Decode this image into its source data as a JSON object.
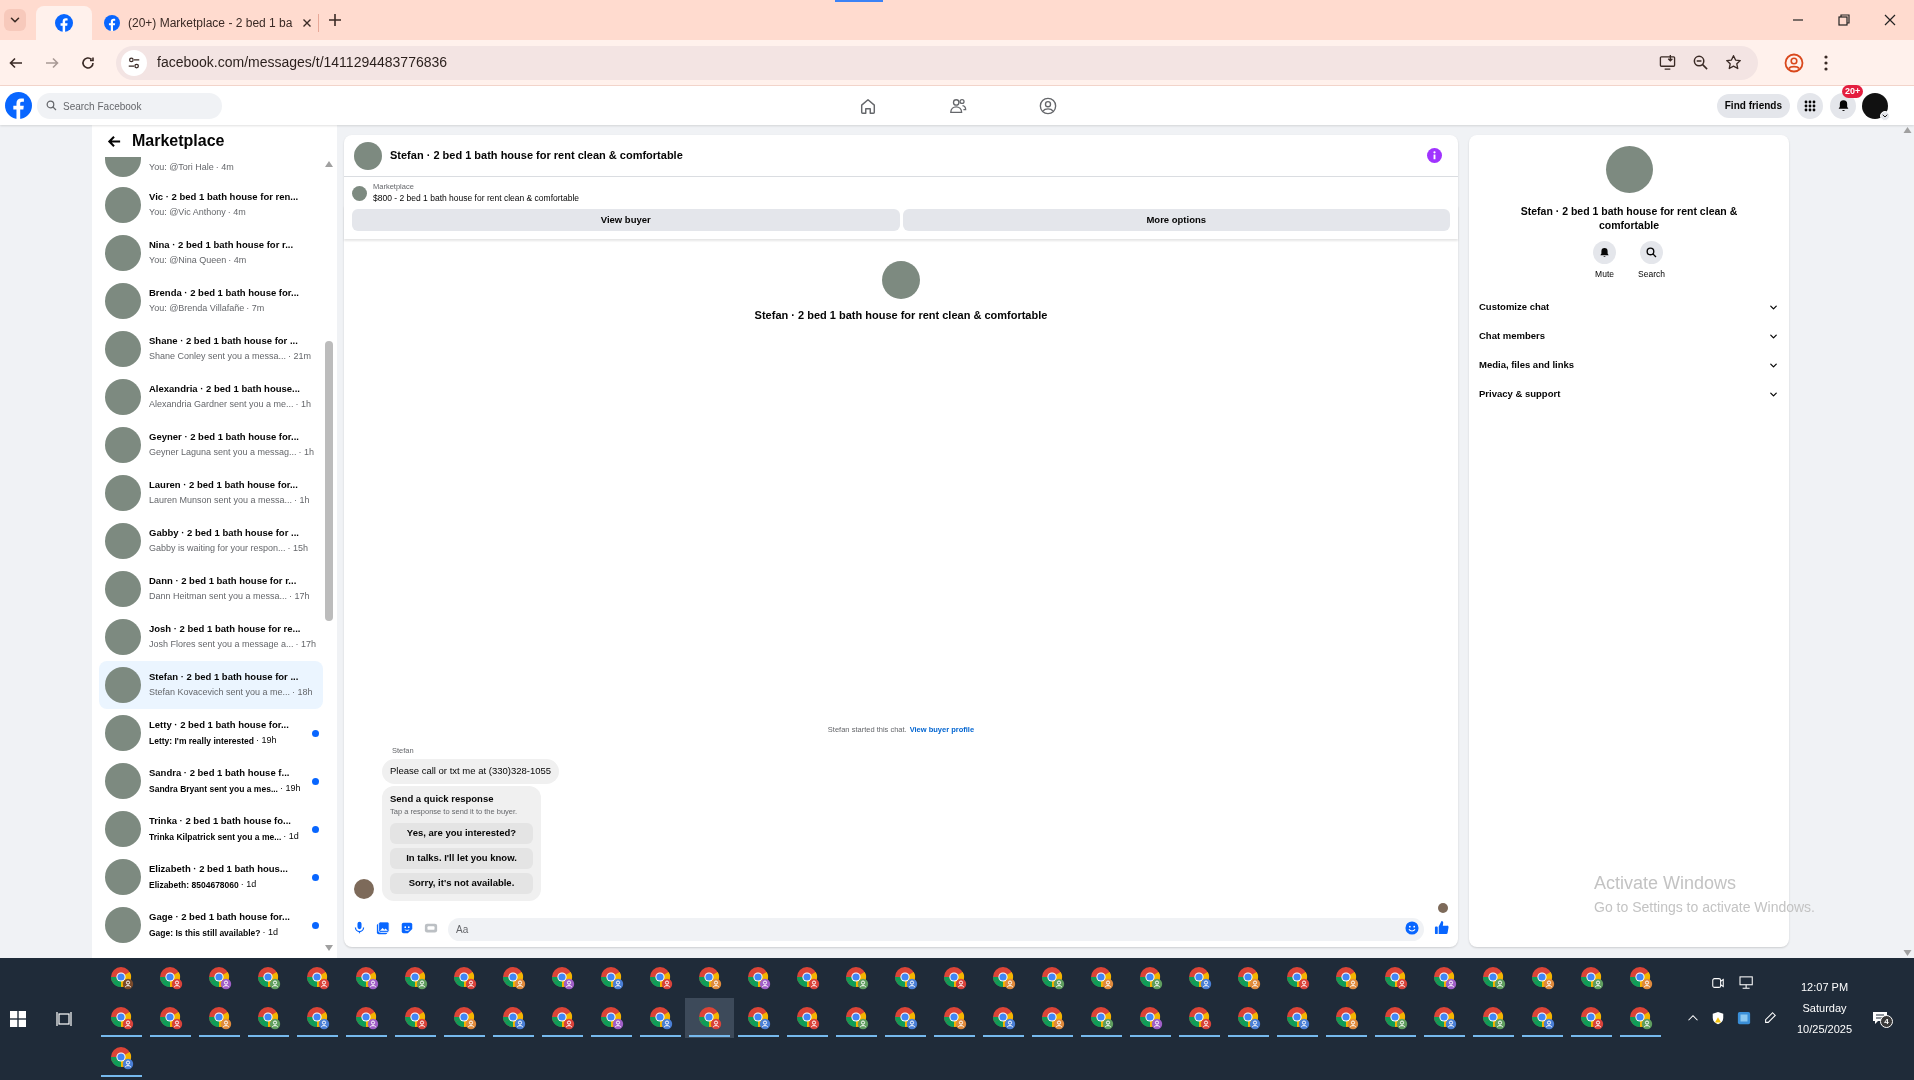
{
  "browser": {
    "tabs": [
      {
        "kind": "pinned",
        "selected": true
      },
      {
        "kind": "normal",
        "title": "(20+) Marketplace - 2 bed 1 ba",
        "selected": false
      }
    ],
    "url": "facebook.com/messages/t/1411294483776836"
  },
  "facebook": {
    "search_placeholder": "Search Facebook",
    "find_friends": "Find friends",
    "notification_badge": "20+"
  },
  "sidebar": {
    "title": "Marketplace",
    "conversations": [
      {
        "kind": "partial",
        "preview": "You: @Tori Hale",
        "time": "· 4m",
        "unread": false,
        "selected": false
      },
      {
        "kind": "full",
        "title": "Vic · 2 bed 1 bath house for ren...",
        "preview": "You: @Vic Anthony",
        "time": "· 4m",
        "unread": false,
        "selected": false
      },
      {
        "kind": "full",
        "title": "Nina · 2 bed 1 bath house for r...",
        "preview": "You: @Nina Queen",
        "time": "· 4m",
        "unread": false,
        "selected": false
      },
      {
        "kind": "full",
        "title": "Brenda · 2 bed 1 bath house for...",
        "preview": "You: @Brenda Villafañe",
        "time": "· 7m",
        "unread": false,
        "selected": false
      },
      {
        "kind": "full",
        "title": "Shane · 2 bed 1 bath house for ...",
        "preview": "Shane Conley sent you a messa...",
        "time": "· 21m",
        "unread": false,
        "selected": false
      },
      {
        "kind": "full",
        "title": "Alexandria · 2 bed 1 bath house...",
        "preview": "Alexandria Gardner sent you a me...",
        "time": "· 1h",
        "unread": false,
        "selected": false
      },
      {
        "kind": "full",
        "title": "Geyner · 2 bed 1 bath house for...",
        "preview": "Geyner Laguna sent you a messag...",
        "time": "· 1h",
        "unread": false,
        "selected": false
      },
      {
        "kind": "full",
        "title": "Lauren · 2 bed 1 bath house for...",
        "preview": "Lauren Munson sent you a messa...",
        "time": "· 1h",
        "unread": false,
        "selected": false
      },
      {
        "kind": "full",
        "title": "Gabby · 2 bed 1 bath house for ...",
        "preview": "Gabby is waiting for your respon...",
        "time": "· 15h",
        "unread": false,
        "selected": false
      },
      {
        "kind": "full",
        "title": "Dann · 2 bed 1 bath house for r...",
        "preview": "Dann Heitman sent you a messa...",
        "time": "· 17h",
        "unread": false,
        "selected": false
      },
      {
        "kind": "full",
        "title": "Josh · 2 bed 1 bath house for re...",
        "preview": "Josh Flores sent you a message a...",
        "time": "· 17h",
        "unread": false,
        "selected": false
      },
      {
        "kind": "full",
        "title": "Stefan · 2 bed 1 bath house for ...",
        "preview": "Stefan Kovacevich sent you a me...",
        "time": "· 18h",
        "unread": false,
        "selected": true
      },
      {
        "kind": "full",
        "title": "Letty · 2 bed 1 bath house for...",
        "preview": "Letty: I'm really interested",
        "time": "· 19h",
        "unread": true,
        "selected": false
      },
      {
        "kind": "full",
        "title": "Sandra · 2 bed 1 bath house f...",
        "preview": "Sandra Bryant sent you a mes...",
        "time": "· 19h",
        "unread": true,
        "selected": false
      },
      {
        "kind": "full",
        "title": "Trinka · 2 bed 1 bath house fo...",
        "preview": "Trinka Kilpatrick sent you a me...",
        "time": "· 1d",
        "unread": true,
        "selected": false
      },
      {
        "kind": "full",
        "title": "Elizabeth · 2 bed 1 bath hous...",
        "preview": "Elizabeth: 8504678060",
        "time": "· 1d",
        "unread": true,
        "selected": false
      },
      {
        "kind": "full",
        "title": "Gage · 2 bed 1 bath house for...",
        "preview": "Gage: Is this still available?",
        "time": "· 1d",
        "unread": true,
        "selected": false
      }
    ]
  },
  "chat": {
    "header_title": "Stefan · 2 bed 1 bath house for rent clean & comfortable",
    "listing": {
      "label": "Marketplace",
      "text": "$800 - 2 bed 1 bath house for rent clean & comfortable"
    },
    "buttons": [
      "View buyer",
      "More options"
    ],
    "intro_title": "Stefan · 2 bed 1 bath house for rent clean & comfortable",
    "started": {
      "text": "Stefan started this chat.",
      "link": "View buyer profile"
    },
    "sender": "Stefan",
    "message": "Please call or txt me at (330)328-1055",
    "quick_response": {
      "title": "Send a quick response",
      "subtitle": "Tap a response to send it to the buyer.",
      "options": [
        "Yes, are you interested?",
        "In talks. I'll let you know.",
        "Sorry, it's not available."
      ]
    },
    "composer": {
      "placeholder": "Aa"
    }
  },
  "details": {
    "title": "Stefan · 2 bed 1 bath house for rent clean & comfortable",
    "actions": [
      "Mute",
      "Search"
    ],
    "sections": [
      {
        "label": "Customize chat",
        "expanded": false
      },
      {
        "label": "Chat members",
        "expanded": false
      },
      {
        "label": "Media, files and links",
        "expanded": false
      },
      {
        "label": "Privacy & support",
        "expanded": false
      }
    ]
  },
  "activation_notice": {
    "title": "Activate Windows",
    "subtitle": "Go to Settings to activate Windows."
  },
  "taskbar": {
    "rows": [
      [
        {
          "running": false,
          "active": false,
          "color": "#7a4a2a"
        },
        {
          "running": false,
          "active": false,
          "color": "#d9423a"
        },
        {
          "running": false,
          "active": false,
          "color": "#a05fc8"
        },
        {
          "running": false,
          "active": false,
          "color": "#5f9e5f"
        },
        {
          "running": false,
          "active": false,
          "color": "#d9423a"
        },
        {
          "running": false,
          "active": false,
          "color": "#a05fc8"
        },
        {
          "running": false,
          "active": false,
          "color": "#5f9e5f"
        },
        {
          "running": false,
          "active": false,
          "color": "#d9423a"
        },
        {
          "running": false,
          "active": false,
          "color": "#e08a3c"
        },
        {
          "running": false,
          "active": false,
          "color": "#a05fc8"
        },
        {
          "running": false,
          "active": false,
          "color": "#4a7fd6"
        },
        {
          "running": false,
          "active": false,
          "color": "#d9423a"
        },
        {
          "running": false,
          "active": false,
          "color": "#e08a3c"
        },
        {
          "running": false,
          "active": false,
          "color": "#a05fc8"
        },
        {
          "running": false,
          "active": false,
          "color": "#d9423a"
        },
        {
          "running": false,
          "active": false,
          "color": "#5f9e5f"
        },
        {
          "running": false,
          "active": false,
          "color": "#4a7fd6"
        },
        {
          "running": false,
          "active": false,
          "color": "#d9423a"
        },
        {
          "running": false,
          "active": false,
          "color": "#e08a3c"
        },
        {
          "running": false,
          "active": false,
          "color": "#5f9e5f"
        },
        {
          "running": false,
          "active": false,
          "color": "#e08a3c"
        },
        {
          "running": false,
          "active": false,
          "color": "#5f9e5f"
        },
        {
          "running": false,
          "active": false,
          "color": "#4a7fd6"
        },
        {
          "running": false,
          "active": false,
          "color": "#e08a3c"
        },
        {
          "running": false,
          "active": false,
          "color": "#d9423a"
        },
        {
          "running": false,
          "active": false,
          "color": "#e08a3c"
        },
        {
          "running": false,
          "active": false,
          "color": "#d9423a"
        },
        {
          "running": false,
          "active": false,
          "color": "#a05fc8"
        },
        {
          "running": false,
          "active": false,
          "color": "#5f9e5f"
        },
        {
          "running": false,
          "active": false,
          "color": "#e08a3c"
        },
        {
          "running": false,
          "active": false,
          "color": "#5f9e5f"
        },
        {
          "running": false,
          "active": false,
          "color": "#e08a3c"
        }
      ],
      [
        {
          "running": true,
          "active": false,
          "color": "#d9423a"
        },
        {
          "running": true,
          "active": false,
          "color": "#d9423a"
        },
        {
          "running": true,
          "active": false,
          "color": "#e08a3c"
        },
        {
          "running": true,
          "active": false,
          "color": "#5f9e5f"
        },
        {
          "running": true,
          "active": false,
          "color": "#4a7fd6"
        },
        {
          "running": true,
          "active": false,
          "color": "#a05fc8"
        },
        {
          "running": true,
          "active": false,
          "color": "#d9423a"
        },
        {
          "running": true,
          "active": false,
          "color": "#e08a3c"
        },
        {
          "running": true,
          "active": false,
          "color": "#4a7fd6"
        },
        {
          "running": true,
          "active": false,
          "color": "#d9423a"
        },
        {
          "running": true,
          "active": false,
          "color": "#a05fc8"
        },
        {
          "running": true,
          "active": false,
          "color": "#4a7fd6"
        },
        {
          "running": true,
          "active": true,
          "color": "#d9423a"
        },
        {
          "running": true,
          "active": false,
          "color": "#4a7fd6"
        },
        {
          "running": true,
          "active": false,
          "color": "#d9423a"
        },
        {
          "running": true,
          "active": false,
          "color": "#5f9e5f"
        },
        {
          "running": true,
          "active": false,
          "color": "#4a7fd6"
        },
        {
          "running": true,
          "active": false,
          "color": "#e08a3c"
        },
        {
          "running": true,
          "active": false,
          "color": "#4a7fd6"
        },
        {
          "running": true,
          "active": false,
          "color": "#e08a3c"
        },
        {
          "running": true,
          "active": false,
          "color": "#5f9e5f"
        },
        {
          "running": true,
          "active": false,
          "color": "#a05fc8"
        },
        {
          "running": true,
          "active": false,
          "color": "#d9423a"
        },
        {
          "running": true,
          "active": false,
          "color": "#4a7fd6"
        },
        {
          "running": true,
          "active": false,
          "color": "#4a7fd6"
        },
        {
          "running": true,
          "active": false,
          "color": "#e08a3c"
        },
        {
          "running": true,
          "active": false,
          "color": "#5f9e5f"
        },
        {
          "running": true,
          "active": false,
          "color": "#4a7fd6"
        },
        {
          "running": true,
          "active": false,
          "color": "#5f9e5f"
        },
        {
          "running": true,
          "active": false,
          "color": "#4a7fd6"
        },
        {
          "running": true,
          "active": false,
          "color": "#d9423a"
        },
        {
          "running": true,
          "active": false,
          "color": "#5f9e5f"
        }
      ],
      [
        {
          "running": true,
          "active": false,
          "color": "#4a7fd6"
        }
      ]
    ],
    "clock": {
      "time": "12:07 PM",
      "day": "Saturday",
      "date": "10/25/2025"
    },
    "notification_count": "4"
  }
}
